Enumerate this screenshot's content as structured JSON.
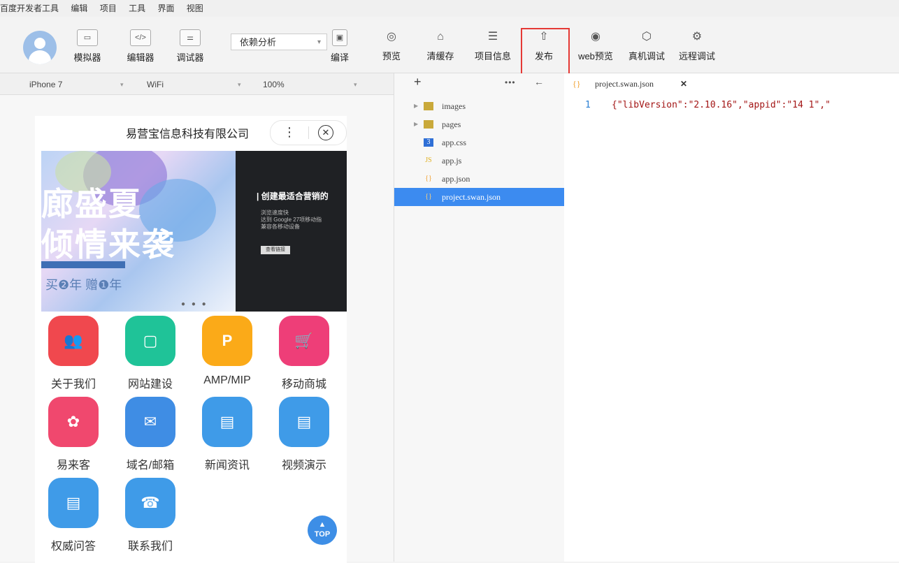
{
  "menu": [
    "百度开发者工具",
    "编辑",
    "项目",
    "工具",
    "界面",
    "视图"
  ],
  "toolbar": {
    "simulator": "模拟器",
    "editor": "编辑器",
    "debugger": "调试器",
    "dependency": "依赖分析",
    "compile": "编译",
    "preview": "预览",
    "clear_cache": "清缓存",
    "project_info": "项目信息",
    "publish": "发布",
    "web_preview": "web预览",
    "device_debug": "真机调试",
    "remote_debug": "远程调试"
  },
  "device_bar": {
    "device": "iPhone 7",
    "network": "WiFi",
    "zoom": "100%"
  },
  "phone": {
    "title": "易营宝信息科技有限公司",
    "more": "⋮",
    "close": "✕",
    "banner_left_line1": "廊盛夏",
    "banner_left_line2": "倾情来袭",
    "banner_left_buy": "买❷年 赠❶年",
    "banner_right_heading": "| 创建最适合营销的",
    "banner_right_text": "浏览速度快\n达到 Google 27项移动指\n兼容各移动设备",
    "banner_right_button": "查看链接",
    "grid": [
      {
        "label": "关于我们",
        "color": "#f0484e",
        "icon": "👥"
      },
      {
        "label": "网站建设",
        "color": "#1fc398",
        "icon": "▢"
      },
      {
        "label": "AMP/MIP",
        "color": "#fbaa18",
        "icon": "P"
      },
      {
        "label": "移动商城",
        "color": "#ee3e78",
        "icon": "🛒"
      },
      {
        "label": "易来客",
        "color": "#f0486e",
        "icon": "✿"
      },
      {
        "label": "域名/邮箱",
        "color": "#3f8de4",
        "icon": "✉"
      },
      {
        "label": "新闻资讯",
        "color": "#3f9be8",
        "icon": "▤"
      },
      {
        "label": "视频演示",
        "color": "#3f9be8",
        "icon": "▤"
      },
      {
        "label": "权威问答",
        "color": "#3f9be8",
        "icon": "▤"
      },
      {
        "label": "联系我们",
        "color": "#3f9be8",
        "icon": "☎"
      }
    ],
    "top_button": "TOP"
  },
  "tree": {
    "items": [
      {
        "name": "images",
        "type": "folder"
      },
      {
        "name": "pages",
        "type": "folder"
      },
      {
        "name": "app.css",
        "type": "css"
      },
      {
        "name": "app.js",
        "type": "js"
      },
      {
        "name": "app.json",
        "type": "json"
      },
      {
        "name": "project.swan.json",
        "type": "json",
        "selected": true
      }
    ]
  },
  "editor": {
    "tab": "project.swan.json",
    "line_number": "1",
    "code": "{\"libVersion\":\"2.10.16\",\"appid\":\"14       1\",\""
  },
  "colors": {
    "accent": "#3c8bf0",
    "highlight": "#e53935"
  }
}
